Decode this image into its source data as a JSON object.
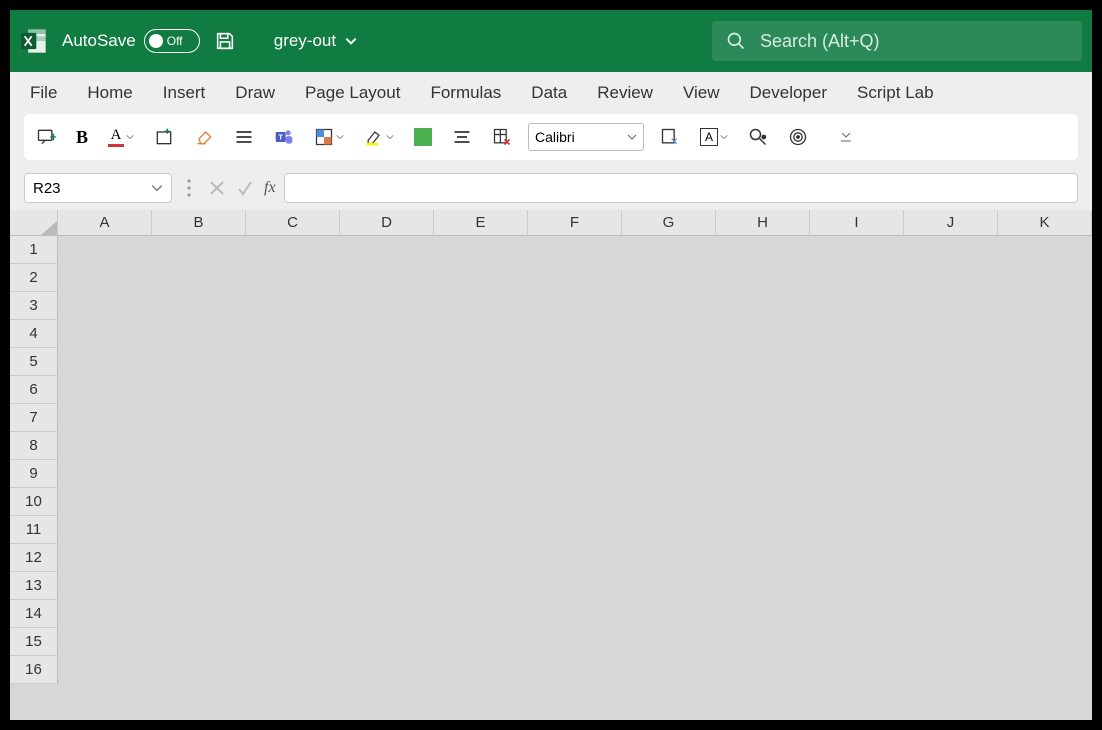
{
  "titlebar": {
    "autosave_label": "AutoSave",
    "autosave_state": "Off",
    "file_name": "grey-out",
    "search_placeholder": "Search (Alt+Q)"
  },
  "ribbon": {
    "tabs": [
      "File",
      "Home",
      "Insert",
      "Draw",
      "Page Layout",
      "Formulas",
      "Data",
      "Review",
      "View",
      "Developer",
      "Script Lab"
    ]
  },
  "toolbar": {
    "font_name": "Calibri"
  },
  "formula_bar": {
    "name_box": "R23",
    "formula": ""
  },
  "grid": {
    "columns": [
      "A",
      "B",
      "C",
      "D",
      "E",
      "F",
      "G",
      "H",
      "I",
      "J",
      "K"
    ],
    "rows": [
      "1",
      "2",
      "3",
      "4",
      "5",
      "6",
      "7",
      "8",
      "9",
      "10",
      "11",
      "12",
      "13",
      "14",
      "15",
      "16"
    ]
  },
  "colors": {
    "brand": "#107c41",
    "grid_bg": "#d7d7d7"
  }
}
